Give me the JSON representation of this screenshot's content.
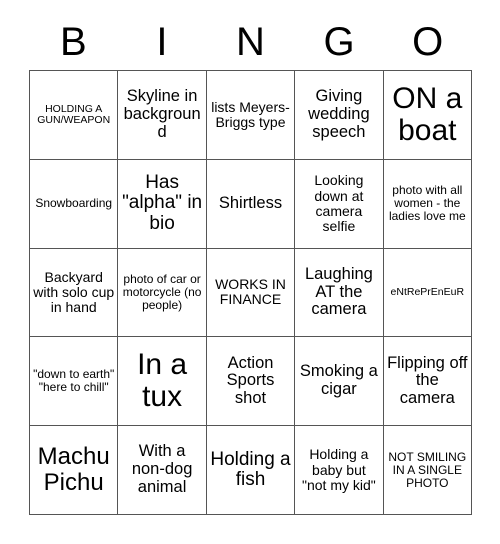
{
  "card": {
    "title": "BINGO",
    "header_letters": [
      "B",
      "I",
      "N",
      "G",
      "O"
    ],
    "grid_size": "5x5",
    "colors": {
      "background": "#ffffff",
      "cell_background": "#ffffff",
      "border": "#555555",
      "text": "#000000"
    },
    "rows": [
      [
        {
          "text": "HOLDING A GUN/WEAPON",
          "size": "xxs"
        },
        {
          "text": "Skyline in background",
          "size": "m"
        },
        {
          "text": "lists Meyers-Briggs type",
          "size": "s"
        },
        {
          "text": "Giving wedding speech",
          "size": "m"
        },
        {
          "text": "ON a boat",
          "size": "xxl"
        }
      ],
      [
        {
          "text": "Snowboarding",
          "size": "xs"
        },
        {
          "text": "Has \"alpha\" in bio",
          "size": "l"
        },
        {
          "text": "Shirtless",
          "size": "m"
        },
        {
          "text": "Looking down at camera selfie",
          "size": "s"
        },
        {
          "text": "photo with all women - the ladies love me",
          "size": "xs"
        }
      ],
      [
        {
          "text": "Backyard with solo cup in hand",
          "size": "s"
        },
        {
          "text": "photo of car or motorcycle (no people)",
          "size": "xs"
        },
        {
          "text": "WORKS IN FINANCE",
          "size": "s"
        },
        {
          "text": "Laughing AT the camera",
          "size": "m"
        },
        {
          "text": "eNtRePrEnEuR",
          "size": "xxs"
        }
      ],
      [
        {
          "text": "\"down to earth\" \"here to chill\"",
          "size": "xs"
        },
        {
          "text": "In a tux",
          "size": "xxl"
        },
        {
          "text": "Action Sports shot",
          "size": "m"
        },
        {
          "text": "Smoking a cigar",
          "size": "m"
        },
        {
          "text": "Flipping off the camera",
          "size": "m"
        }
      ],
      [
        {
          "text": "Machu Pichu",
          "size": "xl"
        },
        {
          "text": "With a non-dog animal",
          "size": "m"
        },
        {
          "text": "Holding a fish",
          "size": "l"
        },
        {
          "text": "Holding a baby but \"not my kid\"",
          "size": "s"
        },
        {
          "text": "NOT SMILING IN A SINGLE PHOTO",
          "size": "xs"
        }
      ]
    ]
  }
}
